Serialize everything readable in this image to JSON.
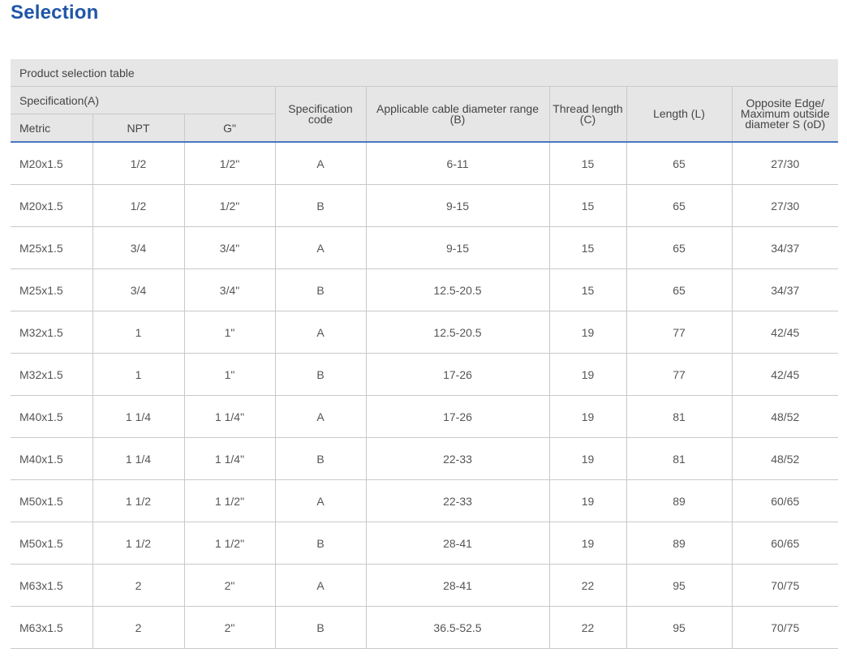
{
  "page": {
    "title": "Selection"
  },
  "table": {
    "caption": "Product selection table",
    "group_header": "Specification(A)",
    "sub_headers": [
      "Metric",
      "NPT",
      "G\""
    ],
    "headers": {
      "spec_code": "Specification code",
      "cable_range": "Applicable cable diameter range (B)",
      "thread_length": "Thread length (C)",
      "length": "Length (L)",
      "opposite_edge": "Opposite Edge/ Maximum outside diameter S (oD)"
    },
    "rows": [
      [
        "M20x1.5",
        "1/2",
        "1/2\"",
        "A",
        "6-11",
        "15",
        "65",
        "27/30"
      ],
      [
        "M20x1.5",
        "1/2",
        "1/2\"",
        "B",
        "9-15",
        "15",
        "65",
        "27/30"
      ],
      [
        "M25x1.5",
        "3/4",
        "3/4\"",
        "A",
        "9-15",
        "15",
        "65",
        "34/37"
      ],
      [
        "M25x1.5",
        "3/4",
        "3/4\"",
        "B",
        "12.5-20.5",
        "15",
        "65",
        "34/37"
      ],
      [
        "M32x1.5",
        "1",
        "1\"",
        "A",
        "12.5-20.5",
        "19",
        "77",
        "42/45"
      ],
      [
        "M32x1.5",
        "1",
        "1\"",
        "B",
        "17-26",
        "19",
        "77",
        "42/45"
      ],
      [
        "M40x1.5",
        "1 1/4",
        "1 1/4\"",
        "A",
        "17-26",
        "19",
        "81",
        "48/52"
      ],
      [
        "M40x1.5",
        "1 1/4",
        "1 1/4\"",
        "B",
        "22-33",
        "19",
        "81",
        "48/52"
      ],
      [
        "M50x1.5",
        "1 1/2",
        "1 1/2\"",
        "A",
        "22-33",
        "19",
        "89",
        "60/65"
      ],
      [
        "M50x1.5",
        "1 1/2",
        "1 1/2\"",
        "B",
        "28-41",
        "19",
        "89",
        "60/65"
      ],
      [
        "M63x1.5",
        "2",
        "2\"",
        "A",
        "28-41",
        "22",
        "95",
        "70/75"
      ],
      [
        "M63x1.5",
        "2",
        "2\"",
        "B",
        "36.5-52.5",
        "22",
        "95",
        "70/75"
      ]
    ]
  },
  "colors": {
    "title": "#1f56a8",
    "header_bg": "#e6e6e6",
    "header_rule": "#4a78c2",
    "grid": "#c9c9c9"
  }
}
